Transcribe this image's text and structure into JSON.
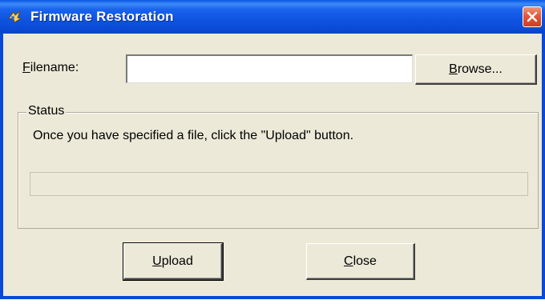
{
  "window": {
    "title": "Firmware Restoration",
    "close_symbol": "close-icon"
  },
  "form": {
    "filename_label_accel": "F",
    "filename_label_rest": "ilename:",
    "filename_value": "",
    "browse_accel": "B",
    "browse_rest": "rowse..."
  },
  "status": {
    "legend": "Status",
    "message": "Once you have specified a file, click the \"Upload\" button.",
    "progress_fraction": 0
  },
  "buttons": {
    "upload_accel": "U",
    "upload_rest": "pload",
    "close_accel": "C",
    "close_rest": "lose"
  },
  "colors": {
    "titlebar": "#0a58e6",
    "dialog_bg": "#ece9d8",
    "close_button": "#e1583a"
  },
  "icons": {
    "title": "firmware-restoration-icon",
    "close": "close-icon"
  }
}
